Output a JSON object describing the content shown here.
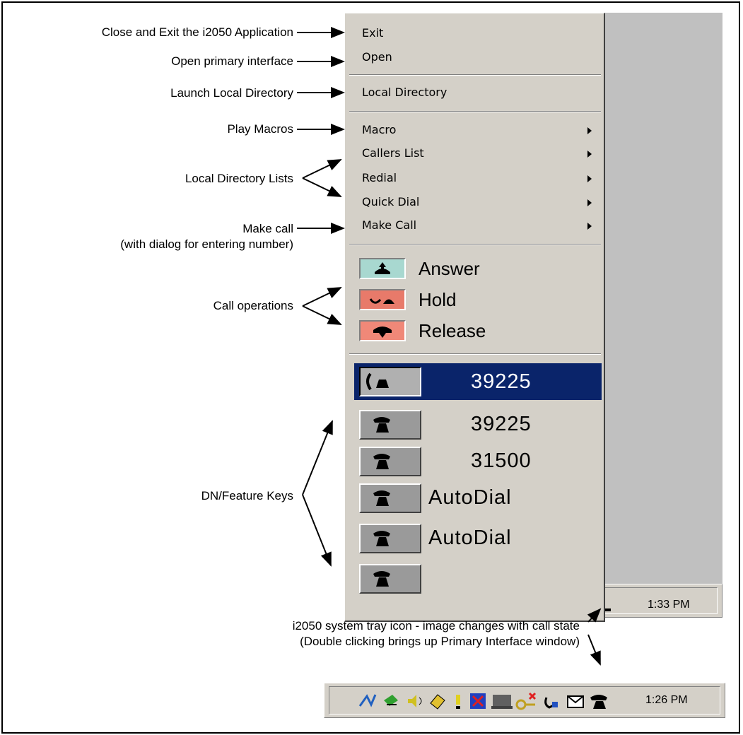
{
  "annotations": {
    "exit": "Close and Exit the i2050 Application",
    "open": "Open primary interface",
    "local_directory": "Launch Local Directory",
    "macros": "Play Macros",
    "lists": "Local Directory Lists",
    "make_call": "Make call",
    "make_call_sub": "(with dialog for entering number)",
    "call_ops": "Call operations",
    "dn_keys": "DN/Feature Keys",
    "tray_line1": "i2050 system tray icon - image changes with call state",
    "tray_line2": "(Double clicking brings up Primary Interface window)"
  },
  "menu": {
    "exit": "Exit",
    "open": "Open",
    "local_directory": "Local Directory",
    "macro": "Macro",
    "callers_list": "Callers List",
    "redial": "Redial",
    "quick_dial": "Quick Dial",
    "make_call": "Make Call",
    "answer": "Answer",
    "hold": "Hold",
    "release": "Release"
  },
  "dn_keys": [
    {
      "label": "39225",
      "selected": true
    },
    {
      "label": "39225",
      "selected": false
    },
    {
      "label": "31500",
      "selected": false
    },
    {
      "label": "AutoDial",
      "selected": false
    },
    {
      "label": "AutoDial",
      "selected": false
    },
    {
      "label": "",
      "selected": false
    }
  ],
  "tray": {
    "top_time": "1:33 PM",
    "bottom_time": "1:26 PM"
  },
  "colors": {
    "selection": "#0a246a",
    "answer_bg": "#a8d8d0",
    "hold_bg": "#e87a6a",
    "release_bg": "#f08878"
  }
}
